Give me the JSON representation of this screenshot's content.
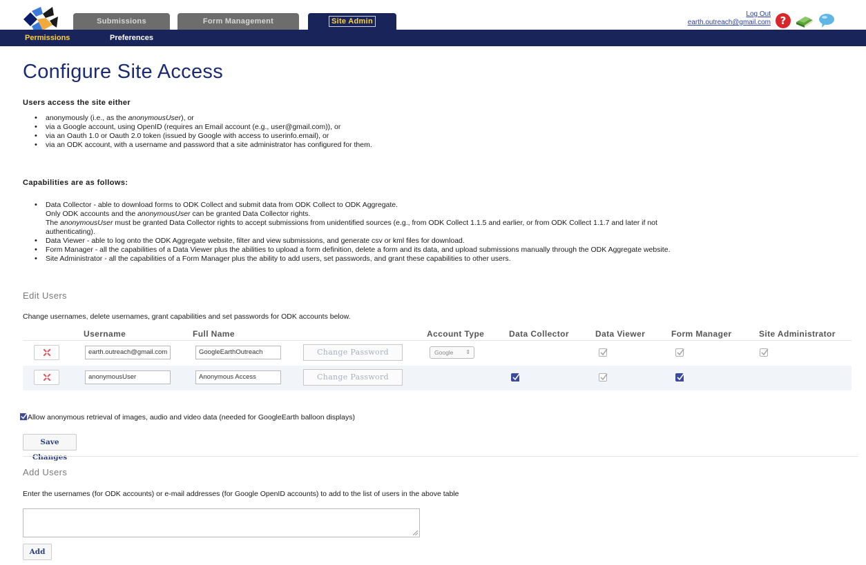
{
  "header": {
    "logo_label": "ODK",
    "tabs": [
      {
        "label": "Submissions",
        "active": false
      },
      {
        "label": "Form Management",
        "active": false
      },
      {
        "label": "Site Admin",
        "active": true
      }
    ],
    "subtabs": [
      {
        "label": "Permissions",
        "active": true
      },
      {
        "label": "Preferences",
        "active": false
      }
    ],
    "logout_label": "Log Out",
    "user_email": "earth.outreach@gmail.com",
    "icons": [
      "help-icon",
      "book-icon",
      "feedback-icon"
    ]
  },
  "page": {
    "title": "Configure Site Access",
    "access_heading": "Users access the site either",
    "access_items": [
      {
        "parts": [
          "anonymously (i.e., as the ",
          "anonymousUser",
          "), or"
        ]
      },
      {
        "text": "via a Google account, using OpenID (requires an Email account (e.g., user@gmail.com)), or"
      },
      {
        "text": "via an Oauth 1.0 or Oauth 2.0 token (issued by Google with access to userinfo.email), or"
      },
      {
        "text": "via an ODK account, with a username and password that a site administrator has configured for them."
      }
    ],
    "capabilities_heading": "Capabilities are as follows:",
    "capabilities": {
      "data_collector": {
        "line1": "Data Collector - able to download forms to ODK Collect and submit data from ODK Collect to ODK Aggregate.",
        "line2": [
          "Only ODK accounts and the ",
          "anonymousUser",
          " can be granted Data Collector rights."
        ],
        "line3": [
          "The ",
          "anonymousUser",
          " must be granted Data Collector rights to accept submissions from unidentified sources (e.g., from ODK Collect 1.1.5 and earlier, or from ODK Collect 1.1.7 and later if not"
        ],
        "line4": "authenticating)."
      },
      "data_viewer": "Data Viewer - able to log onto the ODK Aggregate website, filter and view submissions, and generate csv or kml files for download.",
      "form_manager": "Form Manager - all the capabilities of a Data Viewer plus the abilities to upload a form definition, delete a form and its data, and upload submissions manually through the ODK Aggregate website.",
      "site_admin": "Site Administrator - all the capabilities of a Form Manager plus the ability to add users, set passwords, and grant these capabilities to other users."
    },
    "edit_users": {
      "title": "Edit Users",
      "description": "Change usernames, delete usernames, grant capabilities and set passwords for ODK accounts below.",
      "columns": [
        "Username",
        "Full Name",
        "",
        "Account Type",
        "Data Collector",
        "Data Viewer",
        "Form Manager",
        "Site Administrator"
      ],
      "rows": [
        {
          "username": "earth.outreach@gmail.com",
          "full_name": "GoogleEarthOutreach",
          "password_button": "Change Password",
          "account_type": "Google",
          "data_collector": null,
          "data_viewer": true,
          "form_manager": true,
          "site_administrator": true
        },
        {
          "username": "anonymousUser",
          "full_name": "Anonymous Access",
          "password_button": "Change Password",
          "account_type": "",
          "data_collector": true,
          "data_viewer": true,
          "form_manager": true,
          "site_administrator": null
        }
      ],
      "anonymous_retrieval_label": "Allow anonymous retrieval of images, audio and video data (needed for GoogleEarth balloon displays)",
      "anonymous_retrieval_checked": true,
      "save_button": "Save Changes"
    },
    "add_users": {
      "title": "Add Users",
      "description": "Enter the usernames (for ODK accounts) or e-mail addresses (for Google OpenID accounts) to add to the list of users in the above table",
      "textarea_value": "",
      "add_button": "Add"
    }
  },
  "colors": {
    "navbar": "#18245a",
    "active_tab_text": "#ffd23a",
    "title": "#1c2a73",
    "inactive_tab": "#6d6d6d"
  }
}
